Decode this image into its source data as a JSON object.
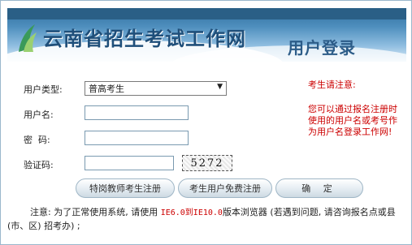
{
  "header": {
    "site_title": "云南省招生考试工作网",
    "login_title": "用户登录",
    "logo_icon": "site-logo-icon"
  },
  "form": {
    "user_type_label": "用户类型:",
    "user_type_value": "普高考生",
    "username_label": "用户名:",
    "username_value": "",
    "password_label": "密  码:",
    "password_value": "",
    "captcha_label": "验证码:",
    "captcha_input_value": "",
    "captcha_text": "5272"
  },
  "notice": {
    "title": "考生请注意:",
    "body": "您可以通过报名注册时使用的用户名或考号作为用户名登录工作网!"
  },
  "buttons": {
    "teacher_register": "特岗教师考生注册",
    "free_register": "考生用户免费注册",
    "confirm": "确  定"
  },
  "footer": {
    "prefix": "注意: 为了正常使用系统, 请使用 ",
    "browser_range": "IE6.0到IE10.0",
    "suffix": "版本浏览器 (若遇到问题, 请咨询报名点或县 (市、区) 招考办) ;"
  },
  "colors": {
    "banner_dark": "#2a5f86",
    "title_blue": "#1f4f7a",
    "notice_red": "#cc0000"
  }
}
